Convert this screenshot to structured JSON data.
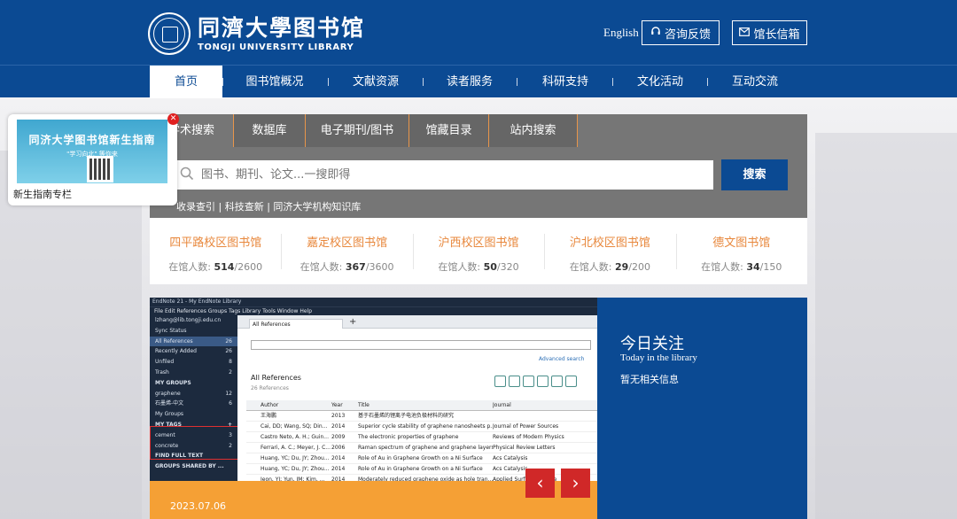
{
  "header": {
    "logo_cn": "同濟大學图书馆",
    "logo_en": "TONGJI UNIVERSITY LIBRARY",
    "lang_link": "English",
    "consult_label": "咨询反馈",
    "mailbox_label": "馆长信箱",
    "consult_icon": "headset-icon",
    "mailbox_icon": "mail-icon"
  },
  "nav": {
    "items": [
      "首页",
      "图书馆概况",
      "文献资源",
      "读者服务",
      "科研支持",
      "文化活动",
      "互动交流"
    ],
    "active": "首页"
  },
  "popup": {
    "image_title": "同济大学图书馆新生指南",
    "image_sub": "\"学习向北\" 等你来",
    "caption": "新生指南专栏"
  },
  "search": {
    "tabs": [
      "学术搜索",
      "数据库",
      "电子期刊/图书",
      "馆藏目录",
      "站内搜索"
    ],
    "active_tab": "学术搜索",
    "placeholder": "图书、期刊、论文...一搜即得",
    "button": "搜索",
    "links": "收录查引 | 科技查新 | 同济大学机构知识库"
  },
  "stats": {
    "label": "在馆人数:",
    "items": [
      {
        "name": "四平路校区图书馆",
        "count": "514",
        "capacity": "2600"
      },
      {
        "name": "嘉定校区图书馆",
        "count": "367",
        "capacity": "3600"
      },
      {
        "name": "沪西校区图书馆",
        "count": "50",
        "capacity": "320"
      },
      {
        "name": "沪北校区图书馆",
        "count": "29",
        "capacity": "200"
      },
      {
        "name": "德文图书馆",
        "count": "34",
        "capacity": "150"
      }
    ]
  },
  "slider": {
    "date": "2023.07.06",
    "prev_icon": "chevron-left-icon",
    "next_icon": "chevron-right-icon",
    "endnote": {
      "title": "EndNote 21 - My EndNote Library",
      "menu": "File  Edit  References  Groups  Tags  Library  Tools  Window  Help",
      "sidebar": [
        {
          "label": "lzhang@lib.tongji.edu.cn",
          "count": ""
        },
        {
          "label": "Sync Status",
          "count": ""
        },
        {
          "label": "All References",
          "count": "26"
        },
        {
          "label": "Recently Added",
          "count": "26"
        },
        {
          "label": "Unfiled",
          "count": "8"
        },
        {
          "label": "Trash",
          "count": "2"
        },
        {
          "label": "MY GROUPS",
          "count": ""
        },
        {
          "label": "graphene",
          "count": "12"
        },
        {
          "label": "石墨烯-中文",
          "count": "6"
        },
        {
          "label": "My Groups",
          "count": ""
        },
        {
          "label": "MY TAGS",
          "count": "+"
        },
        {
          "label": "cement",
          "count": "3"
        },
        {
          "label": "concrete",
          "count": "2"
        },
        {
          "label": "FIND FULL TEXT",
          "count": ""
        },
        {
          "label": "GROUPS SHARED BY ...",
          "count": ""
        }
      ],
      "tab": "All References",
      "advanced": "Advanced search",
      "heading": "All References",
      "subheading": "26 References",
      "columns": [
        "Author",
        "Year",
        "Title",
        "Journal"
      ],
      "rows": [
        [
          "王海鹏",
          "2013",
          "基于石墨烯的锂离子电池负极材料的研究",
          ""
        ],
        [
          "Cai, DD; Wang, SQ; Din...",
          "2014",
          "Superior cycle stability of graphene nanosheets p...",
          "Journal of Power Sources"
        ],
        [
          "Castro Neto, A. H.; Guin...",
          "2009",
          "The electronic properties of graphene",
          "Reviews of Modern Physics"
        ],
        [
          "Ferrari, A. C.; Meyer, J. C...",
          "2006",
          "Raman spectrum of graphene and graphene layers",
          "Physical Review Letters"
        ],
        [
          "Huang, YC; Du, JY; Zhou...",
          "2014",
          "Role of Au in Graphene Growth on a Ni Surface",
          "Acs Catalysis"
        ],
        [
          "Huang, YC; Du, JY; Zhou...",
          "2014",
          "Role of Au in Graphene Growth on a Ni Surface",
          "Acs Catalysis"
        ],
        [
          "Jeon, YJ; Yun, JM; Kim, ...",
          "2014",
          "Moderately reduced graphene oxide as hole tran...",
          "Applied Surface Science"
        ]
      ]
    }
  },
  "feature": {
    "title": "今日关注",
    "subtitle": "Today in the library",
    "message": "暂无相关信息"
  },
  "colors": {
    "brand": "#0b4a93",
    "accent": "#e8883d",
    "arrow": "#d02828"
  }
}
